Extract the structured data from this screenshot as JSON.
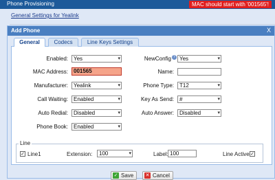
{
  "app": {
    "title": "Phone Provisioning",
    "alert": "MAC should start with '001565'!",
    "settings_link": "General Settings for Yealink"
  },
  "dialog": {
    "title": "Add Phone",
    "close_glyph": "X",
    "tabs": [
      {
        "label": "General",
        "active": true
      },
      {
        "label": "Codecs",
        "active": false
      },
      {
        "label": "Line Keys Settings",
        "active": false
      }
    ]
  },
  "form": {
    "enabled": {
      "label": "Enabled:",
      "value": "Yes"
    },
    "mac": {
      "label": "MAC Address:",
      "value": "001565"
    },
    "manufacturer": {
      "label": "Manufacturer:",
      "value": "Yealink"
    },
    "call_waiting": {
      "label": "Call Waiting:",
      "value": "Enabled"
    },
    "auto_redial": {
      "label": "Auto Redial:",
      "value": "Disabled"
    },
    "phone_book": {
      "label": "Phone Book:",
      "value": "Enabled"
    },
    "new_config": {
      "label": "NewConfig",
      "value": "Yes"
    },
    "name": {
      "label": "Name:",
      "value": ""
    },
    "phone_type": {
      "label": "Phone Type:",
      "value": "T12"
    },
    "key_as_send": {
      "label": "Key As Send:",
      "value": "#"
    },
    "auto_answer": {
      "label": "Auto Answer:",
      "value": "Disabled"
    }
  },
  "line": {
    "legend": "Line",
    "line1": {
      "label": "Line1",
      "checked": true
    },
    "extension": {
      "label": "Extension:",
      "value": "100"
    },
    "label_field": {
      "label": "Label:",
      "value": "100"
    },
    "line_active": {
      "label": "Line Active:",
      "checked": true
    }
  },
  "buttons": {
    "save": "Save",
    "cancel": "Cancel"
  },
  "icons": {
    "dropdown": "chevron-down-icon",
    "help": "help-icon",
    "check": "checkmark-icon",
    "save": "save-icon",
    "cancel": "cancel-icon"
  },
  "colors": {
    "title_bar": "#1d5a9a",
    "alert_bg": "#e01e1e",
    "dialog_header": "#4a7fc1",
    "mac_error_bg": "#f5a48a"
  }
}
